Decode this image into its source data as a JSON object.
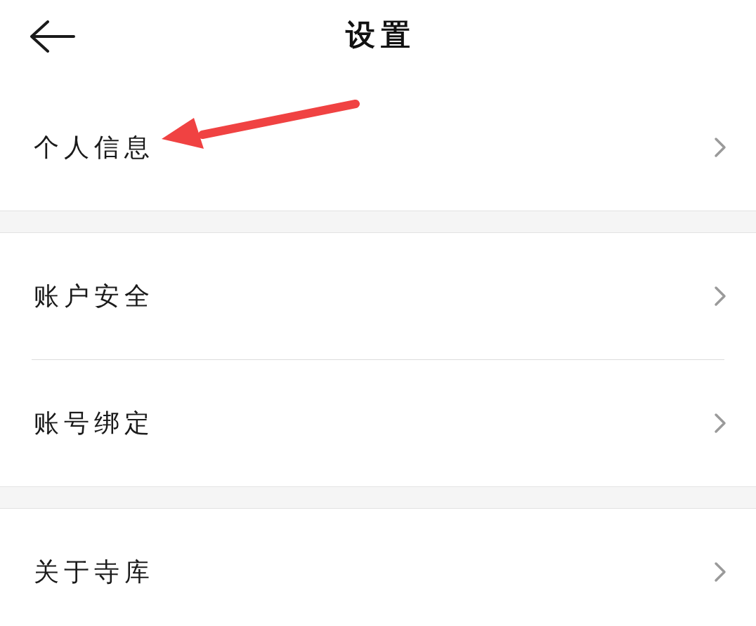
{
  "header": {
    "title": "设置"
  },
  "groups": [
    {
      "items": [
        {
          "label": "个人信息",
          "annotated": true
        }
      ]
    },
    {
      "items": [
        {
          "label": "账户安全",
          "annotated": false
        },
        {
          "label": "账号绑定",
          "annotated": false
        }
      ]
    },
    {
      "items": [
        {
          "label": "关于寺库",
          "annotated": false
        }
      ]
    }
  ]
}
